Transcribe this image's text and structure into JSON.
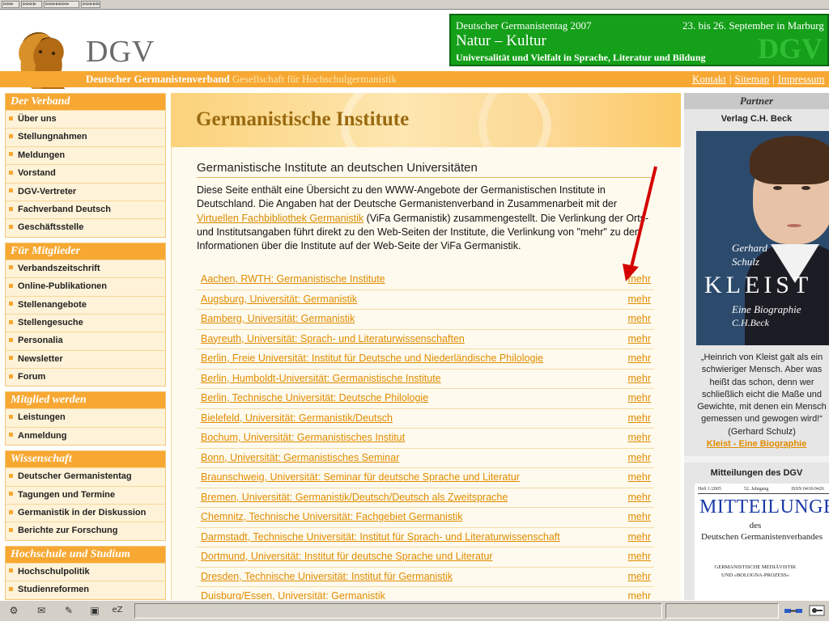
{
  "browser": {
    "toolbar_buttons": [
      "⊳⊳⊳",
      "⊳⊳⊳⊳",
      "⊳⊳⊳⊳⊳⊳⊳",
      "⊳⊳⊳⊳⊳"
    ]
  },
  "header": {
    "logo_text": "DGV",
    "tagline_bold": "Deutscher Germanistenverband",
    "tagline_rest": "Gesellschaft für Hochschulgermanistik",
    "top_links": [
      "Kontakt",
      "Sitemap",
      "Impressum"
    ],
    "banner": {
      "line1": "Deutscher Germanistentag 2007",
      "date": "23. bis 26. September in Marburg",
      "line2": "Natur – Kultur",
      "line3": "Universalität und Vielfalt in Sprache, Literatur und Bildung",
      "watermark": "DGV"
    }
  },
  "nav": [
    {
      "title": "Der Verband",
      "items": [
        "Über uns",
        "Stellungnahmen",
        "Meldungen",
        "Vorstand",
        "DGV-Vertreter",
        "Fachverband Deutsch",
        "Geschäftsstelle"
      ]
    },
    {
      "title": "Für Mitglieder",
      "items": [
        "Verbandszeitschrift",
        "Online-Publikationen",
        "Stellenangebote",
        "Stellengesuche",
        "Personalia",
        "Newsletter",
        "Forum"
      ]
    },
    {
      "title": "Mitglied werden",
      "items": [
        "Leistungen",
        "Anmeldung"
      ]
    },
    {
      "title": "Wissenschaft",
      "items": [
        "Deutscher Germanistentag",
        "Tagungen und Termine",
        "Germanistik in der Diskussion",
        "Berichte zur Forschung"
      ]
    },
    {
      "title": "Hochschule und Studium",
      "items": [
        "Hochschulpolitik",
        "Studienreformen"
      ]
    }
  ],
  "main": {
    "title": "Germanistische Institute",
    "subtitle": "Germanistische Institute an deutschen Universitäten",
    "intro_before_link": "Diese Seite enthält eine Übersicht zu den WWW-Angebote der Germanistischen Institute in Deutschland. Die Angaben hat der Deutsche Germanistenverband in Zusammenarbeit mit der ",
    "intro_link": "Virtuellen Fachbibliothek Germanistik",
    "intro_after_link": " (ViFa Germanistik) zusammengestellt. Die Verlinkung der Orts- und Institutsangaben führt direkt zu den Web-Seiten der Institute, die Verlinkung von \"mehr\" zu den Informationen über die Institute auf der Web-Seite der ViFa Germanistik.",
    "more_label": "mehr",
    "institutes": [
      "Aachen, RWTH: Germanistische Institute",
      "Augsburg, Universität: Germanistik",
      "Bamberg, Universität: Germanistik",
      "Bayreuth, Universität: Sprach- und Literaturwissenschaften",
      "Berlin, Freie Universität: Institut für Deutsche und Niederländische Philologie",
      "Berlin, Humboldt-Universität: Germanistische Institute",
      "Berlin, Technische Universität: Deutsche Philologie",
      "Bielefeld, Universität: Germanistik/Deutsch",
      "Bochum, Universität: Germanistisches Institut",
      "Bonn, Universität: Germanistisches Seminar",
      "Braunschweig, Universität: Seminar für deutsche Sprache und Literatur",
      "Bremen, Universität: Germanistik/Deutsch/Deutsch als Zweitsprache",
      "Chemnitz, Technische Universität: Fachgebiet Germanistik",
      "Darmstadt, Technische Universität: Institut für Sprach- und Literaturwissenschaft",
      "Dortmund, Universität: Institut für deutsche Sprache und Literatur",
      "Dresden, Technische Universität: Institut für Germanistik",
      "Duisburg/Essen, Universität: Germanistik"
    ]
  },
  "sidebar": {
    "partner_title": "Partner",
    "publisher": "Verlag C.H. Beck",
    "book": {
      "author1": "Gerhard",
      "author2": "Schulz",
      "title": "KLEIST",
      "subtitle": "Eine Biographie",
      "publisher": "C.H.Beck"
    },
    "quote": "„Heinrich von Kleist galt als ein schwieriger Mensch. Aber was heißt das schon, denn wer schließlich eicht die Maße und Gewichte, mit denen ein Mensch gemessen und gewogen wird!“ (Gerhard Schulz)",
    "book_link": "Kleist - Eine Biographie",
    "journal_heading": "Mitteilungen des DGV",
    "journal": {
      "meta": [
        "Heft 1/2005",
        "52. Jahrgang",
        "ISSN 0418-9426"
      ],
      "title": "MITTEILUNGEN",
      "des": "des",
      "org": "Deutschen Germanistenverbandes",
      "topic1": "GERMANISTISCHE MEDIÄVISTIK",
      "topic2": "UND »BOLOGNA-PROZESS«"
    }
  },
  "statusbar": {
    "icons": [
      "⚙",
      "✉",
      "✎",
      "▣",
      "eZ"
    ]
  },
  "colors": {
    "accent": "#f7a833",
    "link": "#e08c00",
    "banner_green": "#15a01a",
    "arrow": "#d40000"
  }
}
